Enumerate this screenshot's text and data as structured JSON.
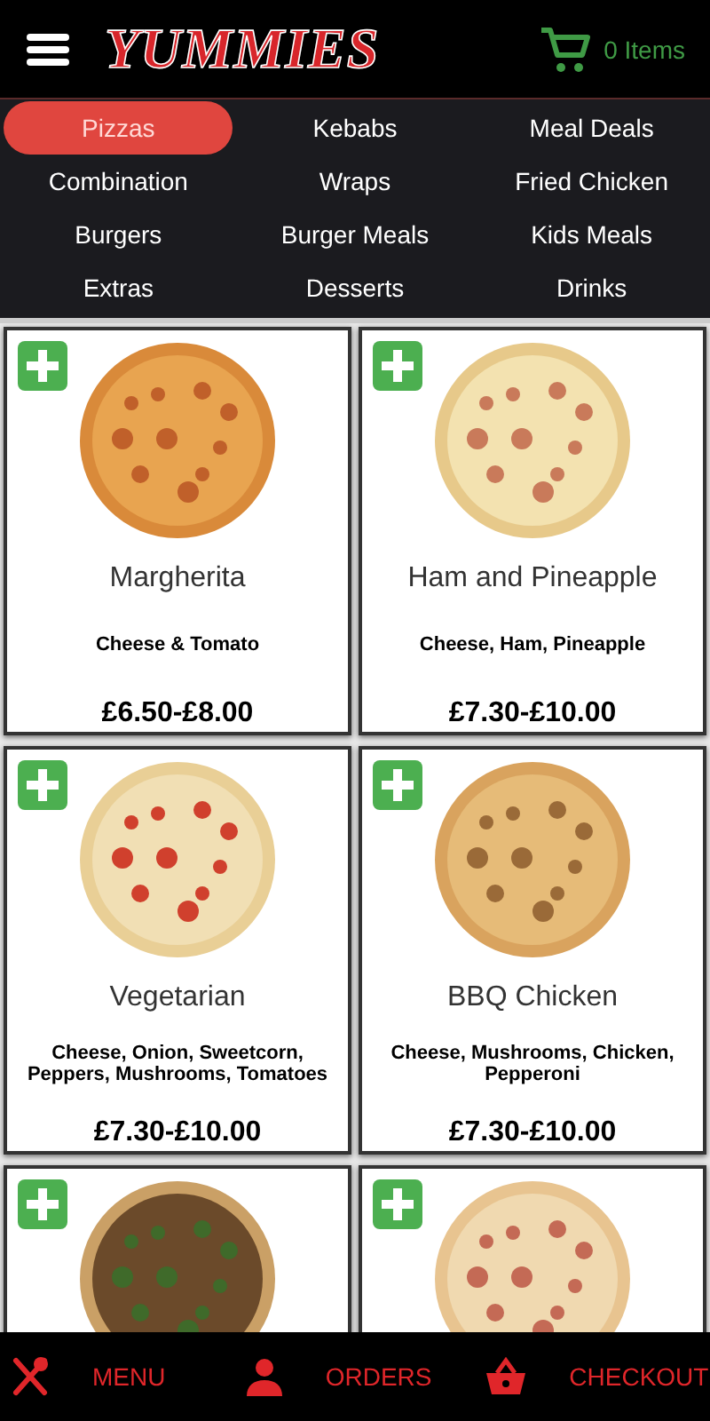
{
  "header": {
    "logo": "YUMMIES",
    "cart_count": "0 Items"
  },
  "categories": [
    {
      "label": "Pizzas",
      "selected": true
    },
    {
      "label": "Kebabs",
      "selected": false
    },
    {
      "label": "Meal Deals",
      "selected": false
    },
    {
      "label": "Combination",
      "selected": false
    },
    {
      "label": "Wraps",
      "selected": false
    },
    {
      "label": "Fried Chicken",
      "selected": false
    },
    {
      "label": "Burgers",
      "selected": false
    },
    {
      "label": "Burger Meals",
      "selected": false
    },
    {
      "label": "Kids Meals",
      "selected": false
    },
    {
      "label": "Extras",
      "selected": false
    },
    {
      "label": "Desserts",
      "selected": false
    },
    {
      "label": "Drinks",
      "selected": false
    }
  ],
  "products": [
    {
      "kind": "full",
      "name": "Margherita",
      "description": "Cheese & Tomato",
      "price": "£6.50-£8.00"
    },
    {
      "kind": "full",
      "name": "Ham and Pineapple",
      "description": "Cheese, Ham, Pineapple",
      "price": "£7.30-£10.00"
    },
    {
      "kind": "full",
      "name": "Vegetarian",
      "description": "Cheese, Onion, Sweetcorn, Peppers, Mushrooms, Tomatoes",
      "price": "£7.30-£10.00"
    },
    {
      "kind": "full",
      "name": "BBQ Chicken",
      "description": "Cheese, Mushrooms, Chicken, Pepperoni",
      "price": "£7.30-£10.00"
    },
    {
      "kind": "partial"
    },
    {
      "kind": "partial"
    }
  ],
  "bottom_nav": [
    {
      "kind": "menu",
      "label": "MENU"
    },
    {
      "kind": "orders",
      "label": "ORDERS"
    },
    {
      "kind": "checkout",
      "label": "CHECKOUT"
    }
  ]
}
